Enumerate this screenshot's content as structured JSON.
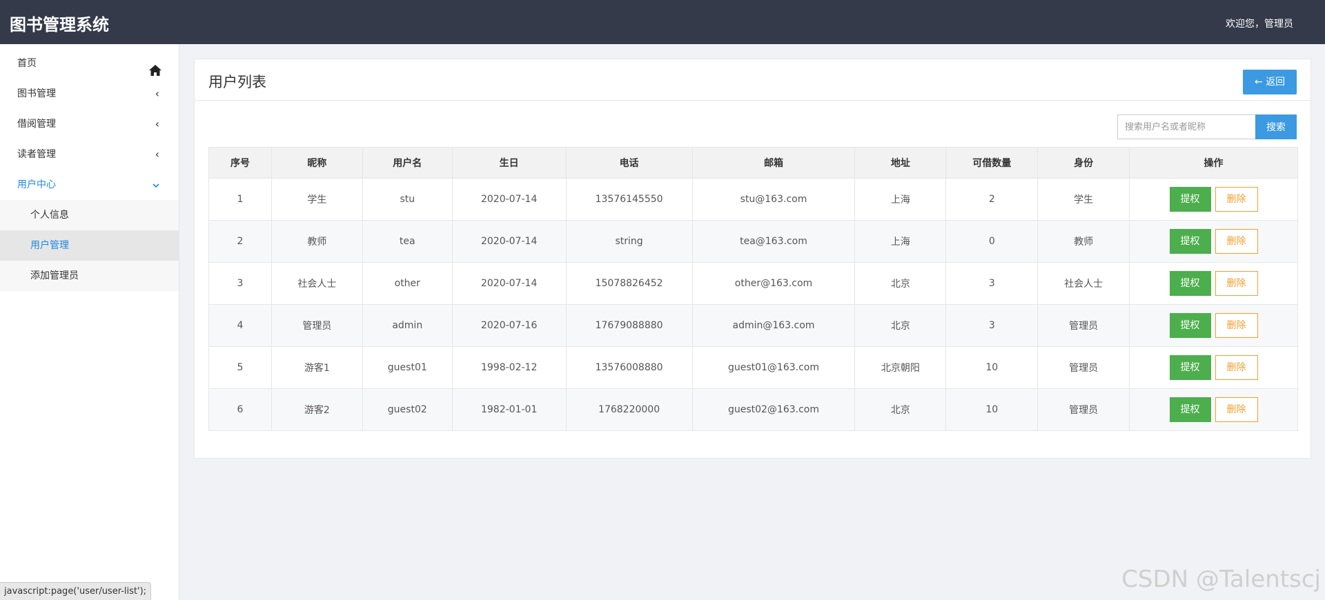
{
  "header": {
    "title": "图书管理系统",
    "welcome": "欢迎您，管理员"
  },
  "sidebar": {
    "items": [
      {
        "label": "首页",
        "icon": "home-icon"
      },
      {
        "label": "图书管理",
        "icon": "chevron-left-icon"
      },
      {
        "label": "借阅管理",
        "icon": "chevron-left-icon"
      },
      {
        "label": "读者管理",
        "icon": "chevron-left-icon"
      },
      {
        "label": "用户中心",
        "icon": "chevron-down-icon"
      }
    ],
    "subitems": [
      {
        "label": "个人信息"
      },
      {
        "label": "用户管理"
      },
      {
        "label": "添加管理员"
      }
    ]
  },
  "panel": {
    "title": "用户列表",
    "back_label": "← 返回"
  },
  "search": {
    "placeholder": "搜索用户名或者昵称",
    "button": "搜索"
  },
  "table": {
    "columns": [
      "序号",
      "昵称",
      "用户名",
      "生日",
      "电话",
      "邮箱",
      "地址",
      "可借数量",
      "身份",
      "操作"
    ],
    "rows": [
      [
        "1",
        "学生",
        "stu",
        "2020-07-14",
        "13576145550",
        "stu@163.com",
        "上海",
        "2",
        "学生"
      ],
      [
        "2",
        "教师",
        "tea",
        "2020-07-14",
        "string",
        "tea@163.com",
        "上海",
        "0",
        "教师"
      ],
      [
        "3",
        "社会人士",
        "other",
        "2020-07-14",
        "15078826452",
        "other@163.com",
        "北京",
        "3",
        "社会人士"
      ],
      [
        "4",
        "管理员",
        "admin",
        "2020-07-16",
        "17679088880",
        "admin@163.com",
        "北京",
        "3",
        "管理员"
      ],
      [
        "5",
        "游客1",
        "guest01",
        "1998-02-12",
        "13576008880",
        "guest01@163.com",
        "北京朝阳",
        "10",
        "管理员"
      ],
      [
        "6",
        "游客2",
        "guest02",
        "1982-01-01",
        "1768220000",
        "guest02@163.com",
        "北京",
        "10",
        "管理员"
      ]
    ],
    "grant_label": "提权",
    "delete_label": "删除"
  },
  "statusbar": {
    "url": "javascript:page('user/user-list');"
  },
  "watermark": "CSDN @Talentscj",
  "colors": {
    "topbar": "#343a4a",
    "accent": "#1e88e5",
    "primary_button": "#3b9ae1",
    "grant_button": "#4cae4c",
    "delete_border": "#f0a030"
  }
}
